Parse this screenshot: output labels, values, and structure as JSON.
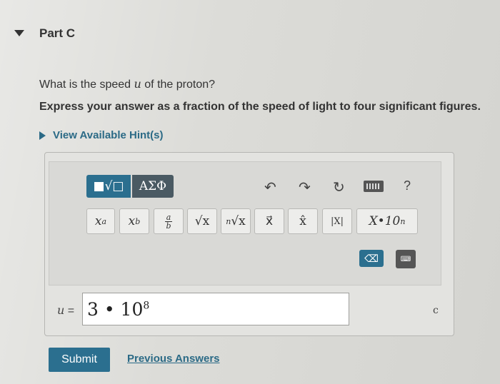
{
  "part": {
    "title": "Part C",
    "toggle_icon": "triangle-down-icon"
  },
  "question": {
    "prefix": "What is the speed ",
    "variable": "u",
    "suffix": " of the proton?"
  },
  "instruction": "Express your answer as a fraction of the speed of light to four significant figures.",
  "hint": {
    "label": "View Available Hint(s)",
    "icon": "triangle-right-icon"
  },
  "toolbar": {
    "mode_templates": "■√□",
    "mode_symbols": "ΑΣΦ",
    "undo": "↶",
    "redo": "↷",
    "reset": "↻",
    "help": "?",
    "buttons": {
      "superscript": {
        "base": "x",
        "exp": "a"
      },
      "subscript": {
        "base": "x",
        "sub": "b"
      },
      "fraction": {
        "num": "a",
        "den": "b"
      },
      "sqrt": "√x",
      "nthroot": {
        "n": "n",
        "rad": "√x"
      },
      "vector": "x⃗",
      "unit_vector": "x̂",
      "abs": "|X|",
      "scientific": {
        "base": "X•",
        "ten": "10",
        "exp": "n"
      }
    },
    "delete_label": "⌫",
    "keyboard_label": "⌨"
  },
  "answer": {
    "label_var": "u",
    "label_eq": " =",
    "value_base": "3 • 10",
    "value_exp": "8",
    "unit": "c"
  },
  "submit_label": "Submit",
  "previous_answers_label": "Previous Answers",
  "colors": {
    "accent": "#2b6f8f",
    "link": "#2b6a86",
    "mode_dark": "#4a5a63"
  }
}
